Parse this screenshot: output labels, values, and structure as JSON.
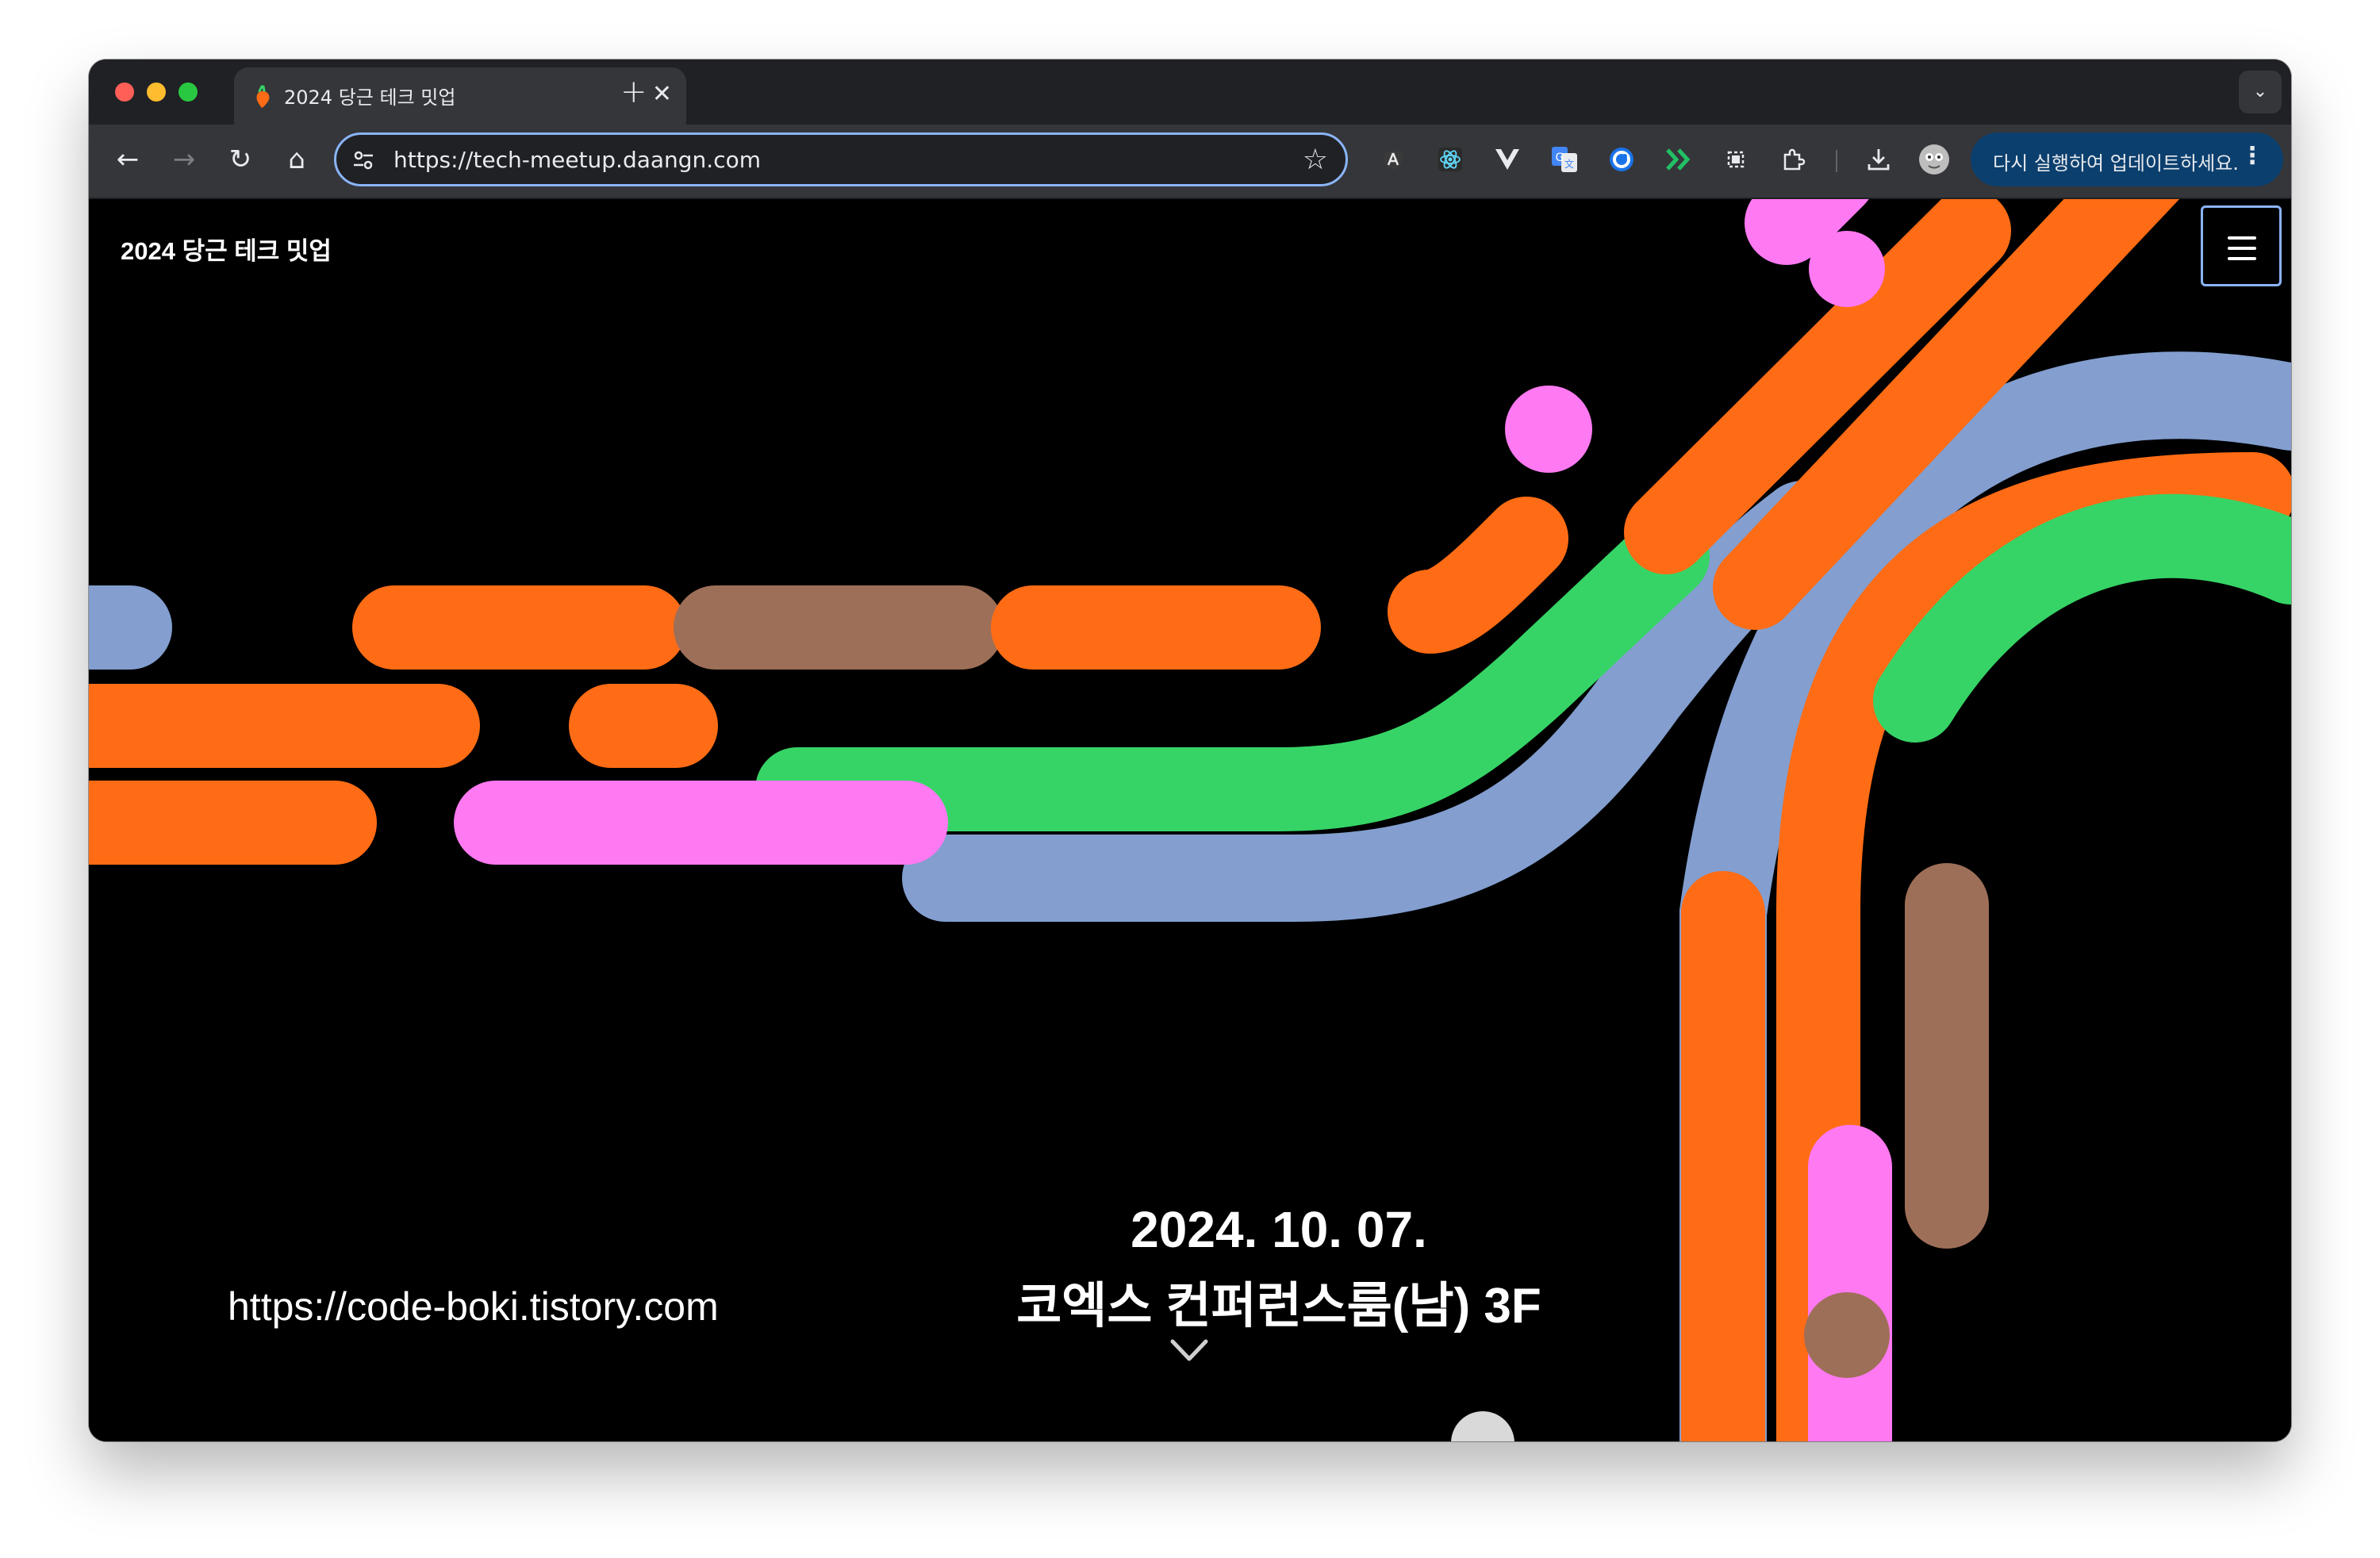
{
  "tab": {
    "title": "2024 당근 테크 밋업",
    "close_glyph": "✕",
    "new_tab_glyph": "+",
    "tab_list_glyph": "⌄"
  },
  "toolbar": {
    "back_glyph": "←",
    "forward_glyph": "→",
    "reload_glyph": "↻",
    "home_glyph": "⌂",
    "url": "https://tech-meetup.daangn.com",
    "bookmark_glyph": "☆",
    "extensions": [
      "angular-devtools-icon",
      "react-devtools-icon",
      "vue-devtools-icon",
      "google-translate-icon",
      "sync-extension-icon",
      "forward-extension-icon",
      "screen-capture-icon",
      "extensions-puzzle-icon",
      "downloads-icon",
      "profile-avatar-icon"
    ],
    "update_label": "다시 실행하여 업데이트하세요.",
    "update_menu_glyph": "⋮"
  },
  "page": {
    "site_title": "2024 당근 테크 밋업",
    "event_date": "2024. 10. 07.",
    "event_venue": "코엑스 컨퍼런스룸(남) 3F",
    "scroll_glyph": "chevron-down",
    "watermark": "https://code-boki.tistory.com"
  },
  "colors": {
    "orange": "#ff6c15",
    "brown": "#9e6f58",
    "green": "#36d466",
    "blue": "#839ecf",
    "pink": "#ff79f2",
    "grey": "#d9d9d9",
    "update_button": "#0b3f6e",
    "focus_ring": "#8ab4f8"
  }
}
